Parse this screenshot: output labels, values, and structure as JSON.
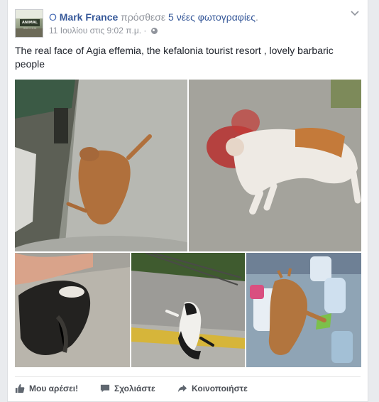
{
  "post": {
    "prefix": "Ο",
    "author": "Mark France",
    "action_text": "πρόσθεσε",
    "photo_count_text": "5 νέες φωτογραφίες",
    "action_suffix": ".",
    "timestamp": "11 Ιουλίου στις 9:02 π.μ.",
    "separator": "·",
    "audience_icon": "globe-icon",
    "menu_icon": "chevron-down-icon",
    "text": "The real face of Agia effemia, the kefalonia tourist resort , lovely barbaric people"
  },
  "photos": [
    {
      "description_icon": "photo-dead-cat-road"
    },
    {
      "description_icon": "photo-dead-cat-blood"
    },
    {
      "description_icon": "photo-injured-black-cat"
    },
    {
      "description_icon": "photo-black-white-cat-curb"
    },
    {
      "description_icon": "photo-cat-in-trash"
    }
  ],
  "actions": {
    "like": "Μου αρέσει!",
    "comment": "Σχολιάστε",
    "share": "Κοινοποιήστε"
  },
  "colors": {
    "link": "#365899",
    "muted": "#90949c",
    "action": "#4b4f56",
    "background": "#e9ebee"
  }
}
